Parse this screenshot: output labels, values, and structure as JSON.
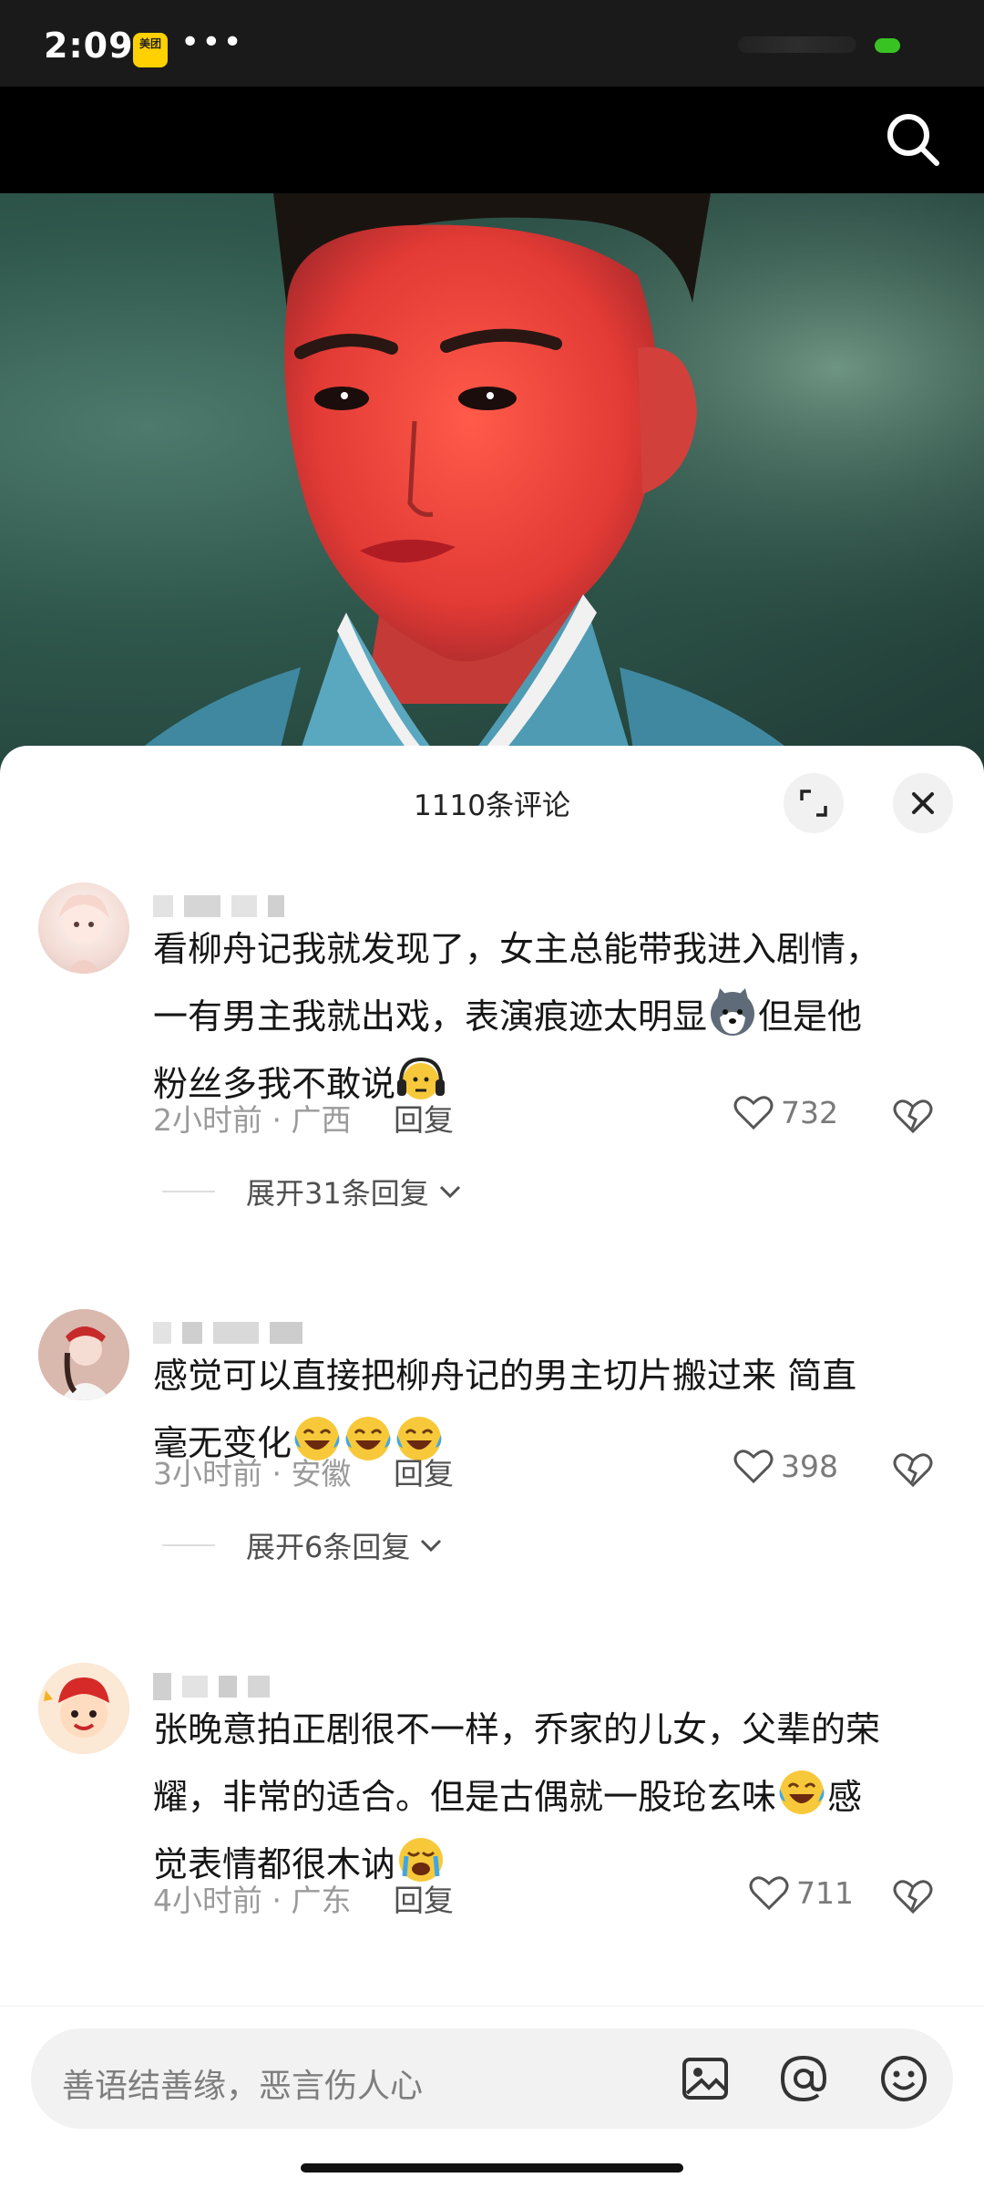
{
  "status_bar": {
    "time": "2:09",
    "app_badge_label": "美团",
    "dots": "•••"
  },
  "colors": {
    "status_green": "#39c322",
    "sheet_bg": "#ffffff",
    "meta_gray": "#9a9a9a"
  },
  "header": {
    "search_icon": "search-icon"
  },
  "sheet": {
    "title": "1110条评论",
    "expand_icon": "expand-icon",
    "close_icon": "close-icon"
  },
  "comments": [
    {
      "text_lines": [
        "看柳舟记我就发现了，女主总能带我进入剧情，",
        "一有男主我就出戏，表演痕迹太明显",
        "但是他",
        "粉丝多我不敢说"
      ],
      "time": "2小时前",
      "sep": "·",
      "location": "广西",
      "reply": "回复",
      "likes": "732",
      "expand": "展开31条回复"
    },
    {
      "text_lines": [
        "感觉可以直接把柳舟记的男主切片搬过来 简直",
        "毫无变化"
      ],
      "time": "3小时前",
      "sep": "·",
      "location": "安徽",
      "reply": "回复",
      "likes": "398",
      "expand": "展开6条回复"
    },
    {
      "text_lines": [
        "张晚意拍正剧很不一样，乔家的儿女，父辈的荣",
        "耀，非常的适合。但是古偶就一股玱玄味",
        "感",
        "觉表情都很木讷"
      ],
      "time": "4小时前",
      "sep": "·",
      "location": "广东",
      "reply": "回复",
      "likes": "711"
    }
  ],
  "input": {
    "placeholder": "善语结善缘，恶言伤人心",
    "icons": [
      "image-icon",
      "at-icon",
      "emoji-icon"
    ]
  }
}
